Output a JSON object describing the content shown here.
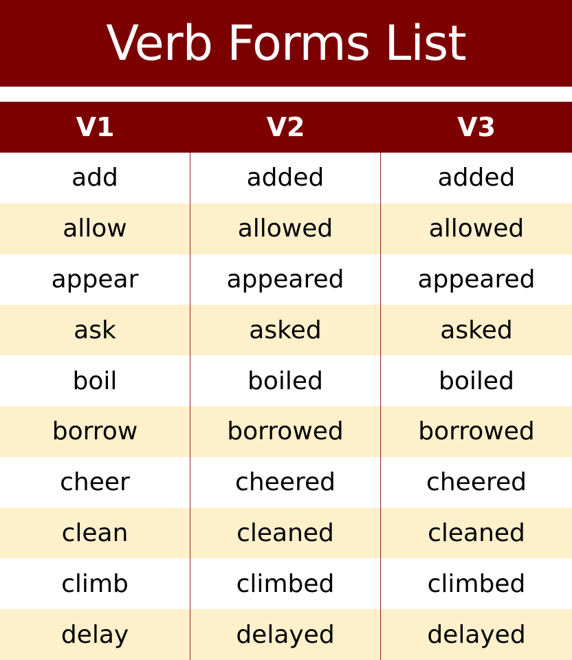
{
  "title": "Verb Forms List",
  "colors": {
    "brand": "#7d0000",
    "row_alt": "#fff0cc",
    "row_plain": "#ffffff",
    "divider": "#9b1c1c"
  },
  "table": {
    "headers": [
      "V1",
      "V2",
      "V3"
    ],
    "rows": [
      [
        "add",
        "added",
        "added"
      ],
      [
        "allow",
        "allowed",
        "allowed"
      ],
      [
        "appear",
        "appeared",
        "appeared"
      ],
      [
        "ask",
        "asked",
        "asked"
      ],
      [
        "boil",
        "boiled",
        "boiled"
      ],
      [
        "borrow",
        "borrowed",
        "borrowed"
      ],
      [
        "cheer",
        "cheered",
        "cheered"
      ],
      [
        "clean",
        "cleaned",
        "cleaned"
      ],
      [
        "climb",
        "climbed",
        "climbed"
      ],
      [
        "delay",
        "delayed",
        "delayed"
      ]
    ]
  }
}
